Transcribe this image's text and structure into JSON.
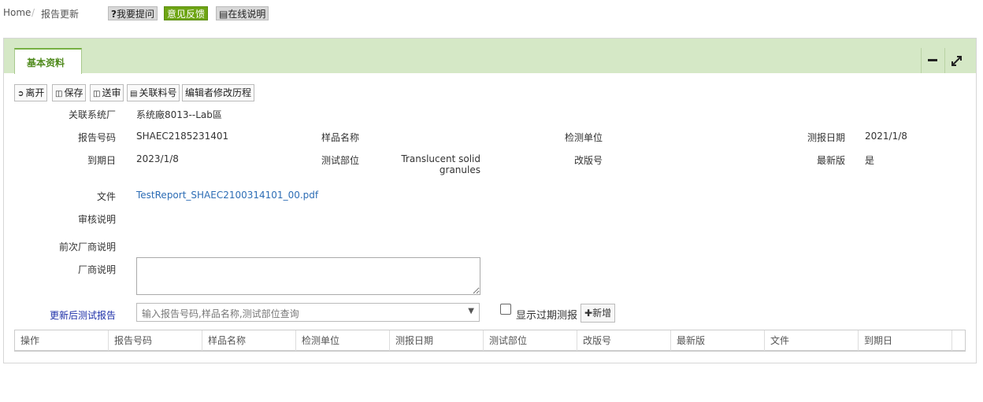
{
  "breadcrumb": {
    "home": "Home",
    "separator": "/",
    "current": "报告更新"
  },
  "toolbar": {
    "ask_prefix": "?",
    "ask_label": "我要提问",
    "feedback_label": "意见反馈",
    "manual_label": "在线说明"
  },
  "tab": {
    "label": "基本资料"
  },
  "header_tools": {
    "collapse": "minus-icon",
    "expand": "expand-icon"
  },
  "actions": {
    "leave": "离开",
    "save": "保存",
    "submit": "送审",
    "related_part": "关联料号",
    "history": "编辑者修改历程"
  },
  "form": {
    "system_factory_label": "关联系统厂",
    "system_factory_value": "系统廠8013--Lab區",
    "report_no_label": "报告号码",
    "report_no_value": "SHAEC2185231401",
    "sample_name_label": "样品名称",
    "sample_name_value": "",
    "test_unit_label": "检测单位",
    "test_unit_value": "",
    "report_date_label": "测报日期",
    "report_date_value": "2021/1/8",
    "expiry_label": "到期日",
    "expiry_value": "2023/1/8",
    "test_part_label": "测试部位",
    "test_part_value_line1": "Translucent solid",
    "test_part_value_line2": "granules",
    "revision_label": "改版号",
    "revision_value": "",
    "latest_label": "最新版",
    "latest_value": "是",
    "file_label": "文件",
    "file_value": "TestReport_SHAEC2100314101_00.pdf",
    "review_note_label": "审核说明",
    "prev_vendor_note_label": "前次厂商说明",
    "vendor_note_label": "厂商说明",
    "vendor_note_value": "",
    "updated_report_label": "更新后测试报告",
    "search_placeholder": "输入报告号码,样品名称,测试部位查询",
    "show_expired_label": "显示过期测报",
    "show_expired_checked": false,
    "add_label": "新增"
  },
  "table": {
    "columns": [
      "操作",
      "报告号码",
      "样品名称",
      "检测单位",
      "测报日期",
      "测试部位",
      "改版号",
      "最新版",
      "文件",
      "到期日"
    ]
  },
  "colors": {
    "accent_green": "#6ea514",
    "panel_head": "#d5e8c6",
    "link": "#2d6db5"
  }
}
